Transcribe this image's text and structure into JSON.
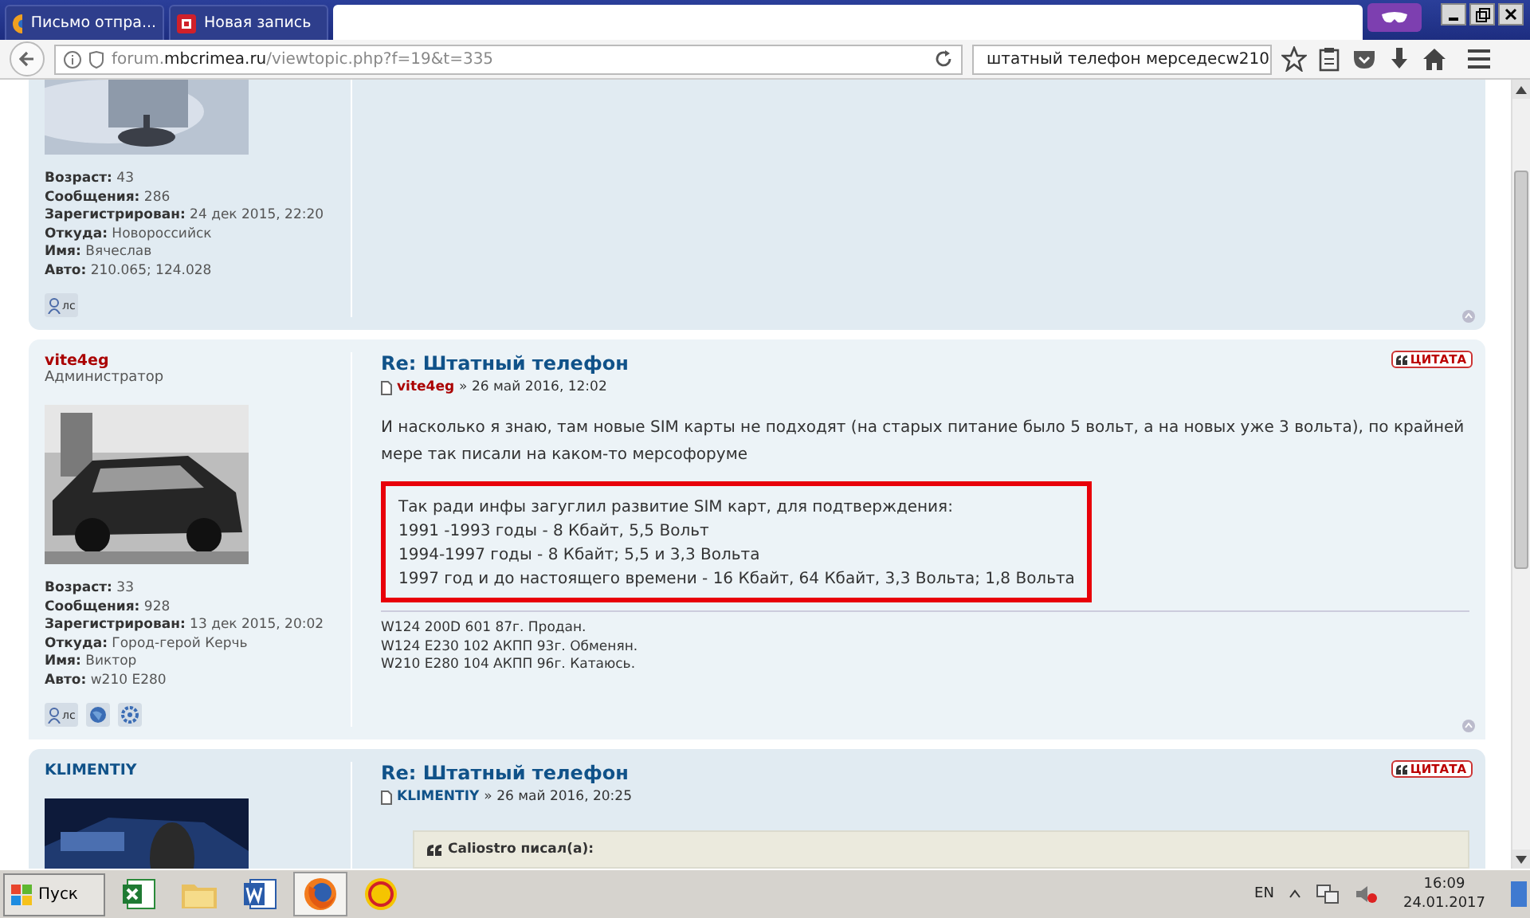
{
  "tabs": [
    {
      "title": "Письмо отпра...",
      "kind": "mail",
      "selected": false
    },
    {
      "title": "Новая запись",
      "kind": "blog",
      "selected": false
    },
    {
      "kind": "blank",
      "selected": true
    }
  ],
  "url": {
    "sub": "forum.",
    "domain": "mbcrimea.ru",
    "path": "/viewtopic.php?f=19&t=335"
  },
  "search": {
    "value": "штатный телефон мерседесw210"
  },
  "posts": [
    {
      "partial": true,
      "profile": [
        {
          "label": "Возраст:",
          "value": "43"
        },
        {
          "label": "Сообщения:",
          "value": "286"
        },
        {
          "label": "Зарегистрирован:",
          "value": "24 дек 2015, 22:20"
        },
        {
          "label": "Откуда:",
          "value": "Новороссийск"
        },
        {
          "label": "Имя:",
          "value": "Вячеслав"
        },
        {
          "label": "Авто:",
          "value": "210.065; 124.028"
        }
      ],
      "contacts": [
        {
          "kind": "pm",
          "label": "лс"
        }
      ]
    },
    {
      "partial": false,
      "author": {
        "name": "vite4eg",
        "role": "Администратор",
        "admin": true
      },
      "title": "Re: Штатный телефон",
      "quote_button": "ЦИТАТА",
      "meta_author": "vite4eg",
      "meta_date": "» 26 май 2016, 12:02",
      "body": "И насколько я знаю, там новые SIM карты не подходят (на старых питание было 5 вольт, а на новых уже 3 вольта), по крайней мере так писали на каком-то мерсофоруме",
      "highlighted": [
        "Так ради инфы загуглил развитие SIM карт, для подтверждения:",
        "1991 -1993 годы - 8 Кбайт, 5,5 Вольт",
        "1994-1997 годы - 8 Кбайт; 5,5 и 3,3 Вольта",
        "1997 год и до настоящего времени - 16 Кбайт, 64 Кбайт, 3,3 Вольта; 1,8 Вольта"
      ],
      "signature": [
        "W124 200D 601 87г. Продан.",
        "W124 E230 102 АКПП 93г. Обменян.",
        "W210 E280 104 АКПП 96г. Катаюсь."
      ],
      "profile": [
        {
          "label": "Возраст:",
          "value": "33"
        },
        {
          "label": "Сообщения:",
          "value": "928"
        },
        {
          "label": "Зарегистрирован:",
          "value": "13 дек 2015, 20:02"
        },
        {
          "label": "Откуда:",
          "value": "Город-герой Керчь"
        },
        {
          "label": "Имя:",
          "value": "Виктор"
        },
        {
          "label": "Авто:",
          "value": "w210 E280"
        }
      ],
      "contacts": [
        {
          "kind": "pm",
          "label": "лс"
        },
        {
          "kind": "globe"
        },
        {
          "kind": "gear"
        }
      ]
    },
    {
      "partial": false,
      "author": {
        "name": "KLIMENTIY",
        "admin": false
      },
      "title": "Re: Штатный телефон",
      "quote_button": "ЦИТАТА",
      "meta_author": "KLIMENTIY",
      "meta_date": "» 26 май 2016, 20:25",
      "quote_header": "Caliostro писал(а):"
    }
  ],
  "taskbar": {
    "start": "Пуск",
    "apps": [
      {
        "kind": "excel",
        "selected": false
      },
      {
        "kind": "folder",
        "selected": false
      },
      {
        "kind": "word",
        "selected": false
      },
      {
        "kind": "firefox",
        "selected": true
      },
      {
        "kind": "onec",
        "selected": false
      }
    ],
    "lang": "EN",
    "time": "16:09",
    "date": "24.01.2017"
  }
}
